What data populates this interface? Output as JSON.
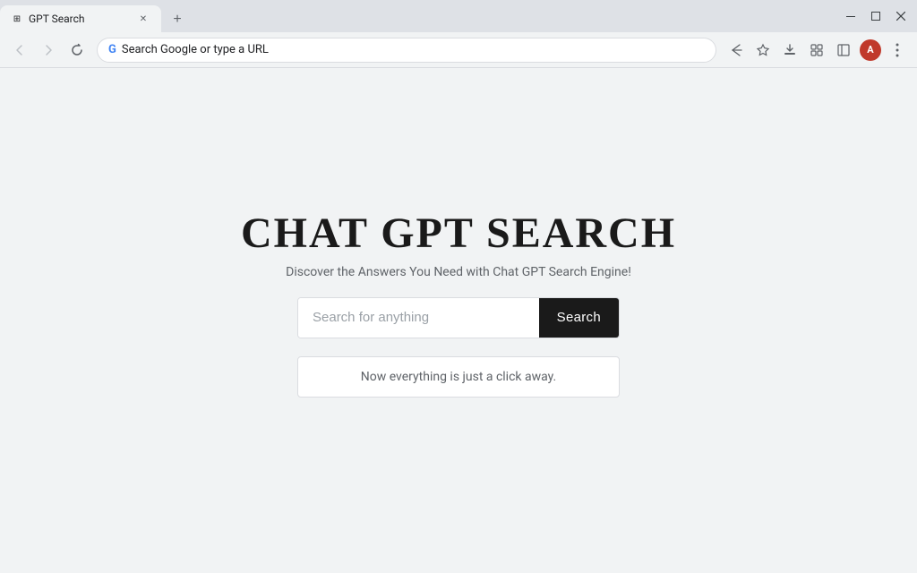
{
  "browser": {
    "tab": {
      "favicon": "⊞",
      "title": "GPT Search",
      "close_label": "✕"
    },
    "new_tab_label": "+",
    "address": {
      "favicon_char": "G",
      "url": "Search Google or type a URL"
    },
    "window_controls": {
      "minimize": "—",
      "maximize": "⬜",
      "close": "✕",
      "more": "⋮"
    },
    "nav": {
      "back": "←",
      "forward": "→",
      "refresh": "↻"
    },
    "toolbar_icons": {
      "bookmark_share": "↗",
      "star": "☆",
      "history": "⊡",
      "extensions": "🧩",
      "sidebar": "⬜",
      "profile": "A",
      "menu": "⋮",
      "downloads": "⬇"
    }
  },
  "page": {
    "title": "CHAT GPT SEARCH",
    "subtitle": "Discover the Answers You Need with Chat GPT Search Engine!",
    "search": {
      "placeholder": "Search for anything",
      "button_label": "Search"
    },
    "info_text": "Now everything is just a click away."
  },
  "colors": {
    "search_btn_bg": "#1a1a1a",
    "search_btn_text": "#ffffff",
    "page_bg": "#f1f3f4",
    "title_color": "#1a1a1a"
  }
}
